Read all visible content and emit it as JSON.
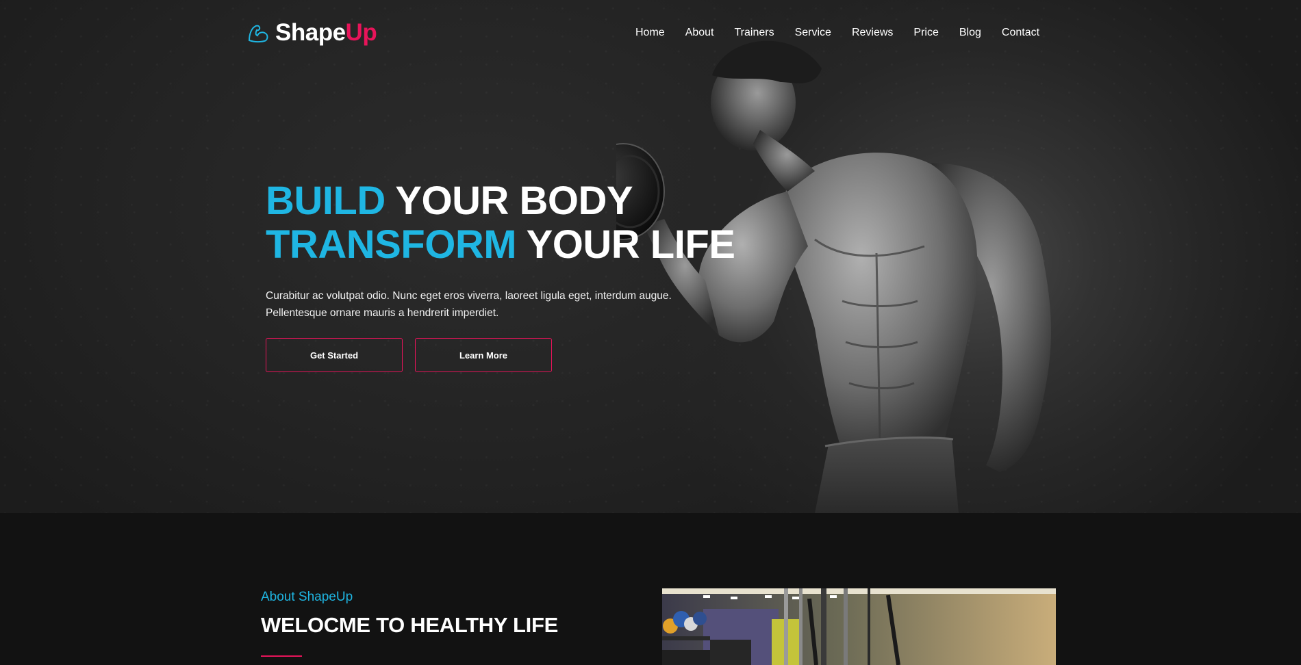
{
  "brand": {
    "part1": "Shape",
    "part2": "Up",
    "icon": "flexed-bicep-icon"
  },
  "nav": [
    {
      "label": "Home"
    },
    {
      "label": "About"
    },
    {
      "label": "Trainers"
    },
    {
      "label": "Service"
    },
    {
      "label": "Reviews"
    },
    {
      "label": "Price"
    },
    {
      "label": "Blog"
    },
    {
      "label": "Contact"
    }
  ],
  "hero": {
    "line1_accent": "BUILD",
    "line1_rest": "YOUR BODY",
    "line2_accent": "TRANSFORM",
    "line2_rest": "YOUR LIFE",
    "description": "Curabitur ac volutpat odio. Nunc eget eros viverra, laoreet ligula eget, interdum augue. Pellentesque ornare mauris a hendrerit imperdiet.",
    "primary_button": "Get Started",
    "secondary_button": "Learn More"
  },
  "about": {
    "kicker": "About ShapeUp",
    "title": "WELOCME TO HEALTHY LIFE"
  },
  "colors": {
    "accent_blue": "#1fb6e3",
    "accent_pink": "#e8145a",
    "background": "#121212"
  }
}
